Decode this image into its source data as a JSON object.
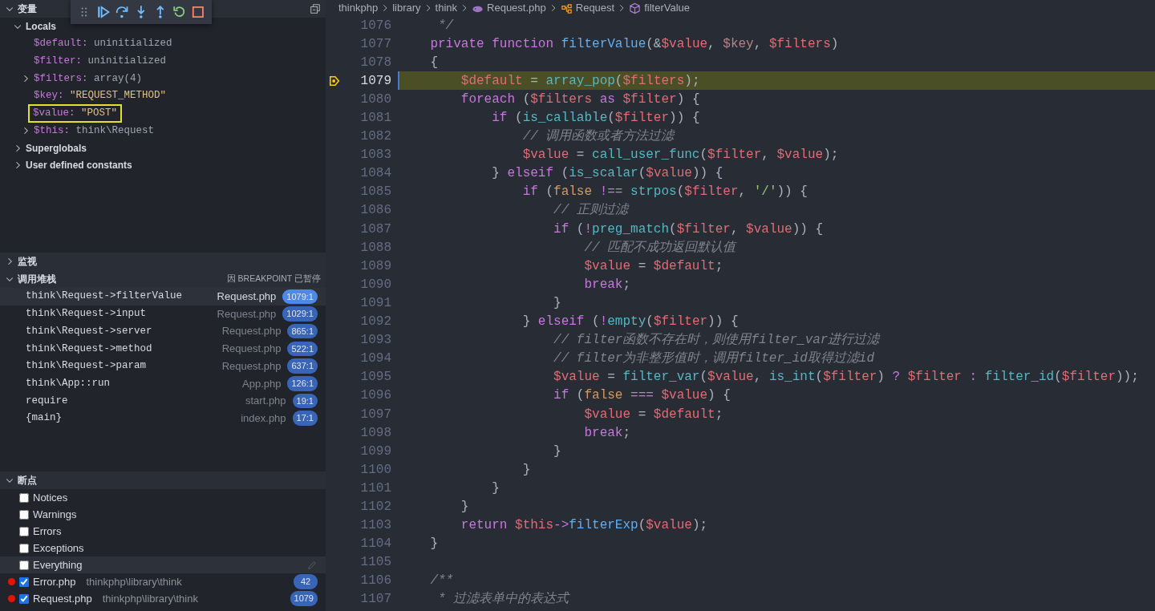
{
  "debug_toolbar": {
    "buttons": [
      {
        "kind": "grip"
      },
      {
        "kind": "continue"
      },
      {
        "kind": "step-over"
      },
      {
        "kind": "step-into"
      },
      {
        "kind": "step-out"
      },
      {
        "kind": "restart"
      },
      {
        "kind": "stop"
      }
    ]
  },
  "variables": {
    "title": "变量",
    "expanded": true,
    "scopes": [
      {
        "label": "Locals",
        "expanded": true,
        "children": [
          {
            "name": "$default:",
            "value": "uninitialized",
            "kind": "plain",
            "expandable": false,
            "highlighted": false
          },
          {
            "name": "$filter:",
            "value": "uninitialized",
            "kind": "plain",
            "expandable": false,
            "highlighted": false
          },
          {
            "name": "$filters:",
            "value": "array(4)",
            "kind": "plain",
            "expandable": true,
            "highlighted": false
          },
          {
            "name": "$key:",
            "value": "\"REQUEST_METHOD\"",
            "kind": "string",
            "expandable": false,
            "highlighted": false
          },
          {
            "name": "$value:",
            "value": "\"POST\"",
            "kind": "string",
            "expandable": false,
            "highlighted": true
          },
          {
            "name": "$this:",
            "value": "think\\Request",
            "kind": "plain",
            "expandable": true,
            "highlighted": false
          }
        ]
      },
      {
        "label": "Superglobals",
        "expanded": false
      },
      {
        "label": "User defined constants",
        "expanded": false
      }
    ]
  },
  "watch": {
    "title": "监视",
    "expanded": false
  },
  "call_stack": {
    "title": "调用堆栈",
    "expanded": true,
    "status": "因 BREAKPOINT 已暂停",
    "frames": [
      {
        "name": "think\\Request->filterValue",
        "file": "Request.php",
        "position": "1079:1",
        "selected": true
      },
      {
        "name": "think\\Request->input",
        "file": "Request.php",
        "position": "1029:1",
        "selected": false
      },
      {
        "name": "think\\Request->server",
        "file": "Request.php",
        "position": "865:1",
        "selected": false
      },
      {
        "name": "think\\Request->method",
        "file": "Request.php",
        "position": "522:1",
        "selected": false
      },
      {
        "name": "think\\Request->param",
        "file": "Request.php",
        "position": "637:1",
        "selected": false
      },
      {
        "name": "think\\App::run",
        "file": "App.php",
        "position": "126:1",
        "selected": false
      },
      {
        "name": "require",
        "file": "start.php",
        "position": "19:1",
        "selected": false
      },
      {
        "name": "{main}",
        "file": "index.php",
        "position": "17:1",
        "selected": false
      }
    ]
  },
  "breakpoints": {
    "title": "断点",
    "expanded": true,
    "items": [
      {
        "kind": "exception",
        "label": "Notices",
        "checked": false,
        "hovered": false
      },
      {
        "kind": "exception",
        "label": "Warnings",
        "checked": false,
        "hovered": false
      },
      {
        "kind": "exception",
        "label": "Errors",
        "checked": false,
        "hovered": false
      },
      {
        "kind": "exception",
        "label": "Exceptions",
        "checked": false,
        "hovered": false
      },
      {
        "kind": "exception",
        "label": "Everything",
        "checked": false,
        "hovered": true
      },
      {
        "kind": "file",
        "label": "Error.php",
        "path": "thinkphp\\library\\think",
        "line": "42",
        "checked": true,
        "hovered": false
      },
      {
        "kind": "file",
        "label": "Request.php",
        "path": "thinkphp\\library\\think",
        "line": "1079",
        "checked": true,
        "hovered": false
      }
    ]
  },
  "breadcrumb": [
    {
      "kind": "folder",
      "label": "thinkphp"
    },
    {
      "kind": "folder",
      "label": "library"
    },
    {
      "kind": "folder",
      "label": "think"
    },
    {
      "kind": "php-file",
      "label": "Request.php"
    },
    {
      "kind": "class",
      "label": "Request"
    },
    {
      "kind": "method",
      "label": "filterValue"
    }
  ],
  "editor": {
    "lines": [
      {
        "number": "1076",
        "current": false,
        "tokens": [
          {
            "kind": "cmt",
            "text": "     */"
          }
        ]
      },
      {
        "number": "1077",
        "current": false,
        "tokens": [
          {
            "kind": "kw",
            "text": "    private"
          },
          {
            "kind": "kw",
            "text": " function"
          },
          {
            "kind": "fn",
            "text": " filterValue"
          },
          {
            "kind": "p",
            "text": "(&"
          },
          {
            "kind": "var",
            "text": "$value"
          },
          {
            "kind": "p",
            "text": ","
          },
          {
            "kind": "dim",
            "text": " $key"
          },
          {
            "kind": "p",
            "text": ","
          },
          {
            "kind": "var",
            "text": " $filters"
          },
          {
            "kind": "p",
            "text": ")"
          }
        ]
      },
      {
        "number": "1078",
        "current": false,
        "tokens": [
          {
            "kind": "p",
            "text": "    {"
          }
        ]
      },
      {
        "number": "1079",
        "current": true,
        "tokens": [
          {
            "kind": "var",
            "text": "        $default"
          },
          {
            "kind": "p",
            "text": " = "
          },
          {
            "kind": "bi",
            "text": "array_pop"
          },
          {
            "kind": "p",
            "text": "("
          },
          {
            "kind": "var",
            "text": "$filters"
          },
          {
            "kind": "p",
            "text": ");"
          }
        ]
      },
      {
        "number": "1080",
        "current": false,
        "tokens": [
          {
            "kind": "kw",
            "text": "        foreach"
          },
          {
            "kind": "p",
            "text": " ("
          },
          {
            "kind": "var",
            "text": "$filters"
          },
          {
            "kind": "kw",
            "text": " as"
          },
          {
            "kind": "var",
            "text": " $filter"
          },
          {
            "kind": "p",
            "text": ") {"
          }
        ]
      },
      {
        "number": "1081",
        "current": false,
        "tokens": [
          {
            "kind": "kw",
            "text": "            if"
          },
          {
            "kind": "p",
            "text": " ("
          },
          {
            "kind": "bi",
            "text": "is_callable"
          },
          {
            "kind": "p",
            "text": "("
          },
          {
            "kind": "var",
            "text": "$filter"
          },
          {
            "kind": "p",
            "text": ")) {"
          }
        ]
      },
      {
        "number": "1082",
        "current": false,
        "tokens": [
          {
            "kind": "cmt",
            "text": "                // 调用函数或者方法过滤"
          }
        ]
      },
      {
        "number": "1083",
        "current": false,
        "tokens": [
          {
            "kind": "var",
            "text": "                $value"
          },
          {
            "kind": "p",
            "text": " = "
          },
          {
            "kind": "bi",
            "text": "call_user_func"
          },
          {
            "kind": "p",
            "text": "("
          },
          {
            "kind": "var",
            "text": "$filter"
          },
          {
            "kind": "p",
            "text": ","
          },
          {
            "kind": "var",
            "text": " $value"
          },
          {
            "kind": "p",
            "text": ");"
          }
        ]
      },
      {
        "number": "1084",
        "current": false,
        "tokens": [
          {
            "kind": "p",
            "text": "            }"
          },
          {
            "kind": "kw",
            "text": " elseif"
          },
          {
            "kind": "p",
            "text": " ("
          },
          {
            "kind": "bi",
            "text": "is_scalar"
          },
          {
            "kind": "p",
            "text": "("
          },
          {
            "kind": "var",
            "text": "$value"
          },
          {
            "kind": "p",
            "text": ")) {"
          }
        ]
      },
      {
        "number": "1085",
        "current": false,
        "tokens": [
          {
            "kind": "kw",
            "text": "                if"
          },
          {
            "kind": "p",
            "text": " ("
          },
          {
            "kind": "const",
            "text": "false"
          },
          {
            "kind": "kw",
            "text": " !=="
          },
          {
            "kind": "bi",
            "text": " strpos"
          },
          {
            "kind": "p",
            "text": "("
          },
          {
            "kind": "var",
            "text": "$filter"
          },
          {
            "kind": "p",
            "text": ","
          },
          {
            "kind": "str",
            "text": " '/'"
          },
          {
            "kind": "p",
            "text": ")) {"
          }
        ]
      },
      {
        "number": "1086",
        "current": false,
        "tokens": [
          {
            "kind": "cmt",
            "text": "                    // 正则过滤"
          }
        ]
      },
      {
        "number": "1087",
        "current": false,
        "tokens": [
          {
            "kind": "kw",
            "text": "                    if"
          },
          {
            "kind": "p",
            "text": " ("
          },
          {
            "kind": "kw",
            "text": "!"
          },
          {
            "kind": "bi",
            "text": "preg_match"
          },
          {
            "kind": "p",
            "text": "("
          },
          {
            "kind": "var",
            "text": "$filter"
          },
          {
            "kind": "p",
            "text": ","
          },
          {
            "kind": "var",
            "text": " $value"
          },
          {
            "kind": "p",
            "text": ")) {"
          }
        ]
      },
      {
        "number": "1088",
        "current": false,
        "tokens": [
          {
            "kind": "cmt",
            "text": "                        // 匹配不成功返回默认值"
          }
        ]
      },
      {
        "number": "1089",
        "current": false,
        "tokens": [
          {
            "kind": "var",
            "text": "                        $value"
          },
          {
            "kind": "p",
            "text": " = "
          },
          {
            "kind": "var",
            "text": "$default"
          },
          {
            "kind": "p",
            "text": ";"
          }
        ]
      },
      {
        "number": "1090",
        "current": false,
        "tokens": [
          {
            "kind": "kw",
            "text": "                        break"
          },
          {
            "kind": "p",
            "text": ";"
          }
        ]
      },
      {
        "number": "1091",
        "current": false,
        "tokens": [
          {
            "kind": "p",
            "text": "                    }"
          }
        ]
      },
      {
        "number": "1092",
        "current": false,
        "tokens": [
          {
            "kind": "p",
            "text": "                }"
          },
          {
            "kind": "kw",
            "text": " elseif"
          },
          {
            "kind": "p",
            "text": " ("
          },
          {
            "kind": "kw",
            "text": "!"
          },
          {
            "kind": "bi",
            "text": "empty"
          },
          {
            "kind": "p",
            "text": "("
          },
          {
            "kind": "var",
            "text": "$filter"
          },
          {
            "kind": "p",
            "text": ")) {"
          }
        ]
      },
      {
        "number": "1093",
        "current": false,
        "tokens": [
          {
            "kind": "cmt",
            "text": "                    // filter函数不存在时，则使用filter_var进行过滤"
          }
        ]
      },
      {
        "number": "1094",
        "current": false,
        "tokens": [
          {
            "kind": "cmt",
            "text": "                    // filter为非整形值时，调用filter_id取得过滤id"
          }
        ]
      },
      {
        "number": "1095",
        "current": false,
        "tokens": [
          {
            "kind": "var",
            "text": "                    $value"
          },
          {
            "kind": "p",
            "text": " = "
          },
          {
            "kind": "bi",
            "text": "filter_var"
          },
          {
            "kind": "p",
            "text": "("
          },
          {
            "kind": "var",
            "text": "$value"
          },
          {
            "kind": "p",
            "text": ","
          },
          {
            "kind": "bi",
            "text": " is_int"
          },
          {
            "kind": "p",
            "text": "("
          },
          {
            "kind": "var",
            "text": "$filter"
          },
          {
            "kind": "p",
            "text": ")"
          },
          {
            "kind": "kw",
            "text": " ?"
          },
          {
            "kind": "var",
            "text": " $filter"
          },
          {
            "kind": "kw",
            "text": " :"
          },
          {
            "kind": "bi",
            "text": " filter_id"
          },
          {
            "kind": "p",
            "text": "("
          },
          {
            "kind": "var",
            "text": "$filter"
          },
          {
            "kind": "p",
            "text": "));"
          }
        ]
      },
      {
        "number": "1096",
        "current": false,
        "tokens": [
          {
            "kind": "kw",
            "text": "                    if"
          },
          {
            "kind": "p",
            "text": " ("
          },
          {
            "kind": "const",
            "text": "false"
          },
          {
            "kind": "kw",
            "text": " ==="
          },
          {
            "kind": "var",
            "text": " $value"
          },
          {
            "kind": "p",
            "text": ") {"
          }
        ]
      },
      {
        "number": "1097",
        "current": false,
        "tokens": [
          {
            "kind": "var",
            "text": "                        $value"
          },
          {
            "kind": "p",
            "text": " = "
          },
          {
            "kind": "var",
            "text": "$default"
          },
          {
            "kind": "p",
            "text": ";"
          }
        ]
      },
      {
        "number": "1098",
        "current": false,
        "tokens": [
          {
            "kind": "kw",
            "text": "                        break"
          },
          {
            "kind": "p",
            "text": ";"
          }
        ]
      },
      {
        "number": "1099",
        "current": false,
        "tokens": [
          {
            "kind": "p",
            "text": "                    }"
          }
        ]
      },
      {
        "number": "1100",
        "current": false,
        "tokens": [
          {
            "kind": "p",
            "text": "                }"
          }
        ]
      },
      {
        "number": "1101",
        "current": false,
        "tokens": [
          {
            "kind": "p",
            "text": "            }"
          }
        ]
      },
      {
        "number": "1102",
        "current": false,
        "tokens": [
          {
            "kind": "p",
            "text": "        }"
          }
        ]
      },
      {
        "number": "1103",
        "current": false,
        "tokens": [
          {
            "kind": "kw",
            "text": "        return"
          },
          {
            "kind": "var",
            "text": " $this"
          },
          {
            "kind": "kw",
            "text": "->"
          },
          {
            "kind": "fn",
            "text": "filterExp"
          },
          {
            "kind": "p",
            "text": "("
          },
          {
            "kind": "var",
            "text": "$value"
          },
          {
            "kind": "p",
            "text": ");"
          }
        ]
      },
      {
        "number": "1104",
        "current": false,
        "tokens": [
          {
            "kind": "p",
            "text": "    }"
          }
        ]
      },
      {
        "number": "1105",
        "current": false
      },
      {
        "number": "1106",
        "current": false,
        "tokens": [
          {
            "kind": "cmt",
            "text": "    /**"
          }
        ]
      },
      {
        "number": "1107",
        "current": false,
        "tokens": [
          {
            "kind": "cmt",
            "text": "     * 过滤表单中的表达式"
          }
        ]
      }
    ]
  }
}
